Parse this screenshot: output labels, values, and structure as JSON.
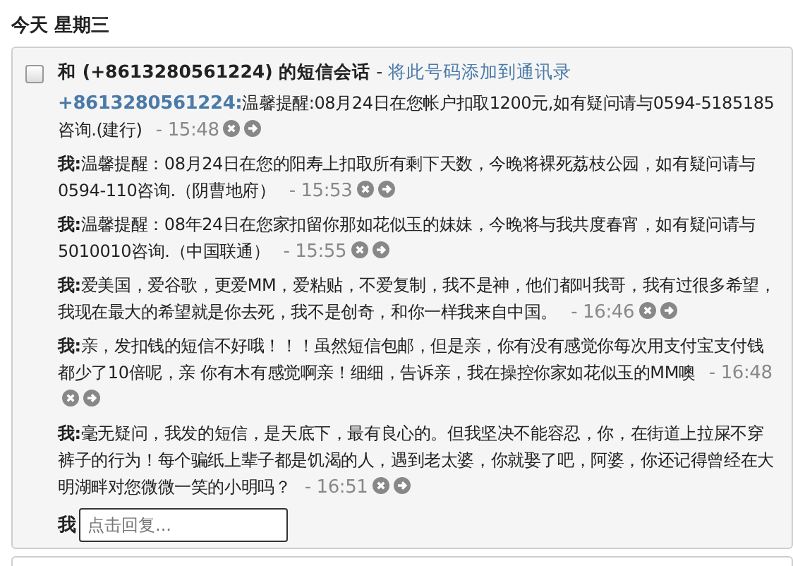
{
  "day_header": "今天 星期三",
  "conversation": {
    "selected": false,
    "title": "和 (+8613280561224) 的短信会话",
    "separator": "-",
    "add_contact_link": "将此号码添加到通讯录",
    "messages": [
      {
        "kind": "them",
        "sender": "+8613280561224:",
        "text": "温馨提醒:08月24日在您帐户扣取1200元,如有疑问请与0594-5185185咨询.(建行)",
        "time": "- 15:48"
      },
      {
        "kind": "me",
        "sender": "我:",
        "text": "温馨提醒：08月24日在您的阳寿上扣取所有剩下天数，今晚将裸死荔枝公园，如有疑问请与0594-110咨询.（阴曹地府）",
        "time": "- 15:53"
      },
      {
        "kind": "me",
        "sender": "我:",
        "text": "温馨提醒：08年24日在您家扣留你那如花似玉的妹妹，今晚将与我共度春宵，如有疑问请与5010010咨询.（中国联通）",
        "time": "- 15:55"
      },
      {
        "kind": "me",
        "sender": "我:",
        "text": "爱美国，爱谷歌，更爱MM，爱粘贴，不爱复制，我不是神，他们都叫我哥，我有过很多希望，我现在最大的希望就是你去死，我不是创奇，和你一样我来自中国。",
        "time": "- 16:46"
      },
      {
        "kind": "me",
        "sender": "我:",
        "text": "亲，发扣钱的短信不好哦！！！虽然短信包邮，但是亲，你有没有感觉你每次用支付宝支付钱都少了10倍呢，亲 你有木有感觉啊亲！细细，告诉亲，我在操控你家如花似玉的MM噢",
        "time": "- 16:48"
      },
      {
        "kind": "me",
        "sender": "我:",
        "text": "毫无疑问，我发的短信，是天底下，最有良心的。但我坚决不能容忍，你，在街道上拉屎不穿裤子的行为！每个骗纸上辈子都是饥渴的人，遇到老太婆，你就娶了吧，阿婆，你还记得曾经在大明湖畔对您微微一笑的小明吗？",
        "time": "- 16:51"
      }
    ],
    "reply": {
      "label": "我",
      "placeholder": "点击回复..."
    }
  }
}
